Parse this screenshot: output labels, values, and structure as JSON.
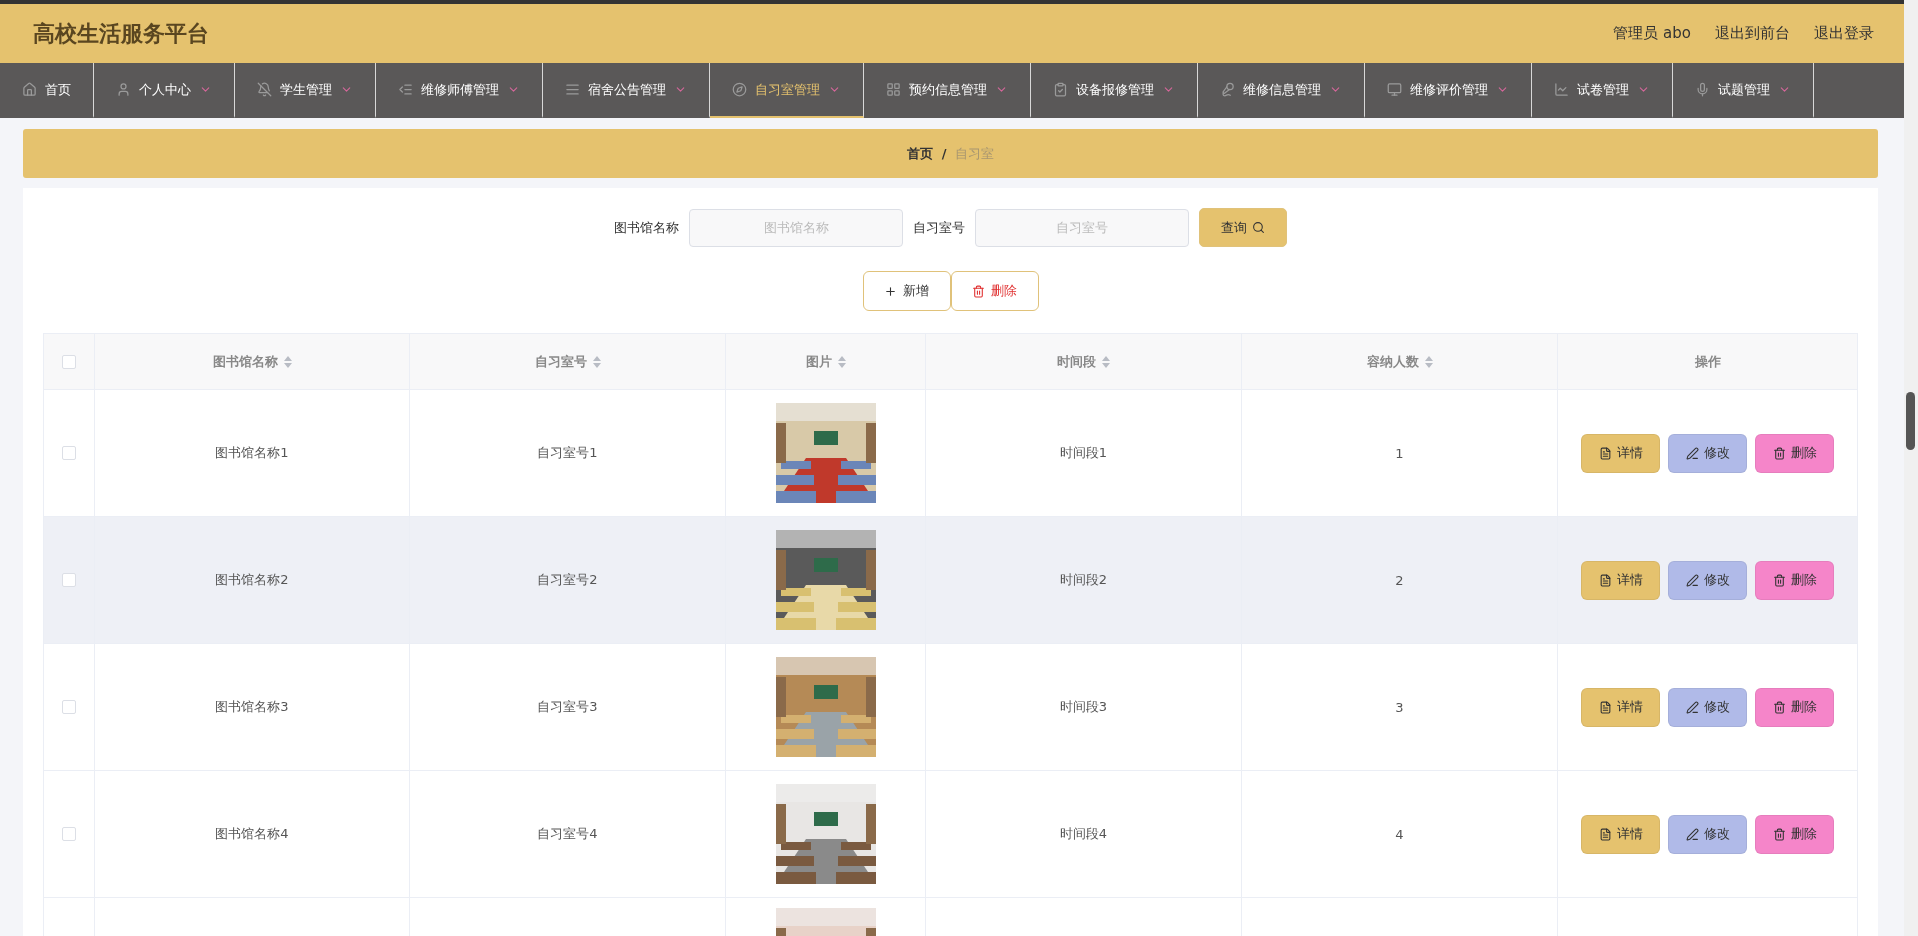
{
  "header": {
    "title": "高校生活服务平台",
    "links": [
      "管理员 abo",
      "退出到前台",
      "退出登录"
    ]
  },
  "nav": [
    {
      "label": "首页",
      "selected": false,
      "kind": "link"
    },
    {
      "label": "个人中心",
      "selected": false,
      "kind": "menu"
    },
    {
      "label": "学生管理",
      "selected": false,
      "kind": "menu"
    },
    {
      "label": "维修师傅管理",
      "selected": false,
      "kind": "menu"
    },
    {
      "label": "宿舍公告管理",
      "selected": false,
      "kind": "menu"
    },
    {
      "label": "自习室管理",
      "selected": true,
      "kind": "menu"
    },
    {
      "label": "预约信息管理",
      "selected": false,
      "kind": "menu"
    },
    {
      "label": "设备报修管理",
      "selected": false,
      "kind": "menu"
    },
    {
      "label": "维修信息管理",
      "selected": false,
      "kind": "menu"
    },
    {
      "label": "维修评价管理",
      "selected": false,
      "kind": "menu"
    },
    {
      "label": "试卷管理",
      "selected": false,
      "kind": "menu"
    },
    {
      "label": "试题管理",
      "selected": false,
      "kind": "menu"
    }
  ],
  "breadcrumb": {
    "home": "首页",
    "separator": "/",
    "current": "自习室"
  },
  "search": {
    "fields": [
      {
        "label": "图书馆名称",
        "placeholder": "图书馆名称"
      },
      {
        "label": "自习室号",
        "placeholder": "自习室号"
      }
    ],
    "button": "查询"
  },
  "actions": {
    "add": "新增",
    "delete": "删除"
  },
  "table": {
    "select_all": {
      "checked": false
    },
    "columns": [
      {
        "label": "图书馆名称",
        "kind": "sortable"
      },
      {
        "label": "自习室号",
        "kind": "sortable"
      },
      {
        "label": "图片",
        "kind": "sortable"
      },
      {
        "label": "时间段",
        "kind": "sortable"
      },
      {
        "label": "容纳人数",
        "kind": "sortable"
      },
      {
        "label": "操作",
        "kind": "plain"
      }
    ],
    "rows": [
      {
        "checked": false,
        "hovered": false,
        "name": "图书馆名称1",
        "room": "自习室号1",
        "period": "时间段1",
        "capacity": "1",
        "buttons": [
          "详情",
          "修改",
          "删除"
        ]
      },
      {
        "checked": false,
        "hovered": true,
        "name": "图书馆名称2",
        "room": "自习室号2",
        "period": "时间段2",
        "capacity": "2",
        "buttons": [
          "详情",
          "修改",
          "删除"
        ]
      },
      {
        "checked": false,
        "hovered": false,
        "name": "图书馆名称3",
        "room": "自习室号3",
        "period": "时间段3",
        "capacity": "3",
        "buttons": [
          "详情",
          "修改",
          "删除"
        ]
      },
      {
        "checked": false,
        "hovered": false,
        "name": "图书馆名称4",
        "room": "自习室号4",
        "period": "时间段4",
        "capacity": "4",
        "buttons": [
          "详情",
          "修改",
          "删除"
        ]
      },
      {
        "kind": "partial"
      }
    ]
  }
}
